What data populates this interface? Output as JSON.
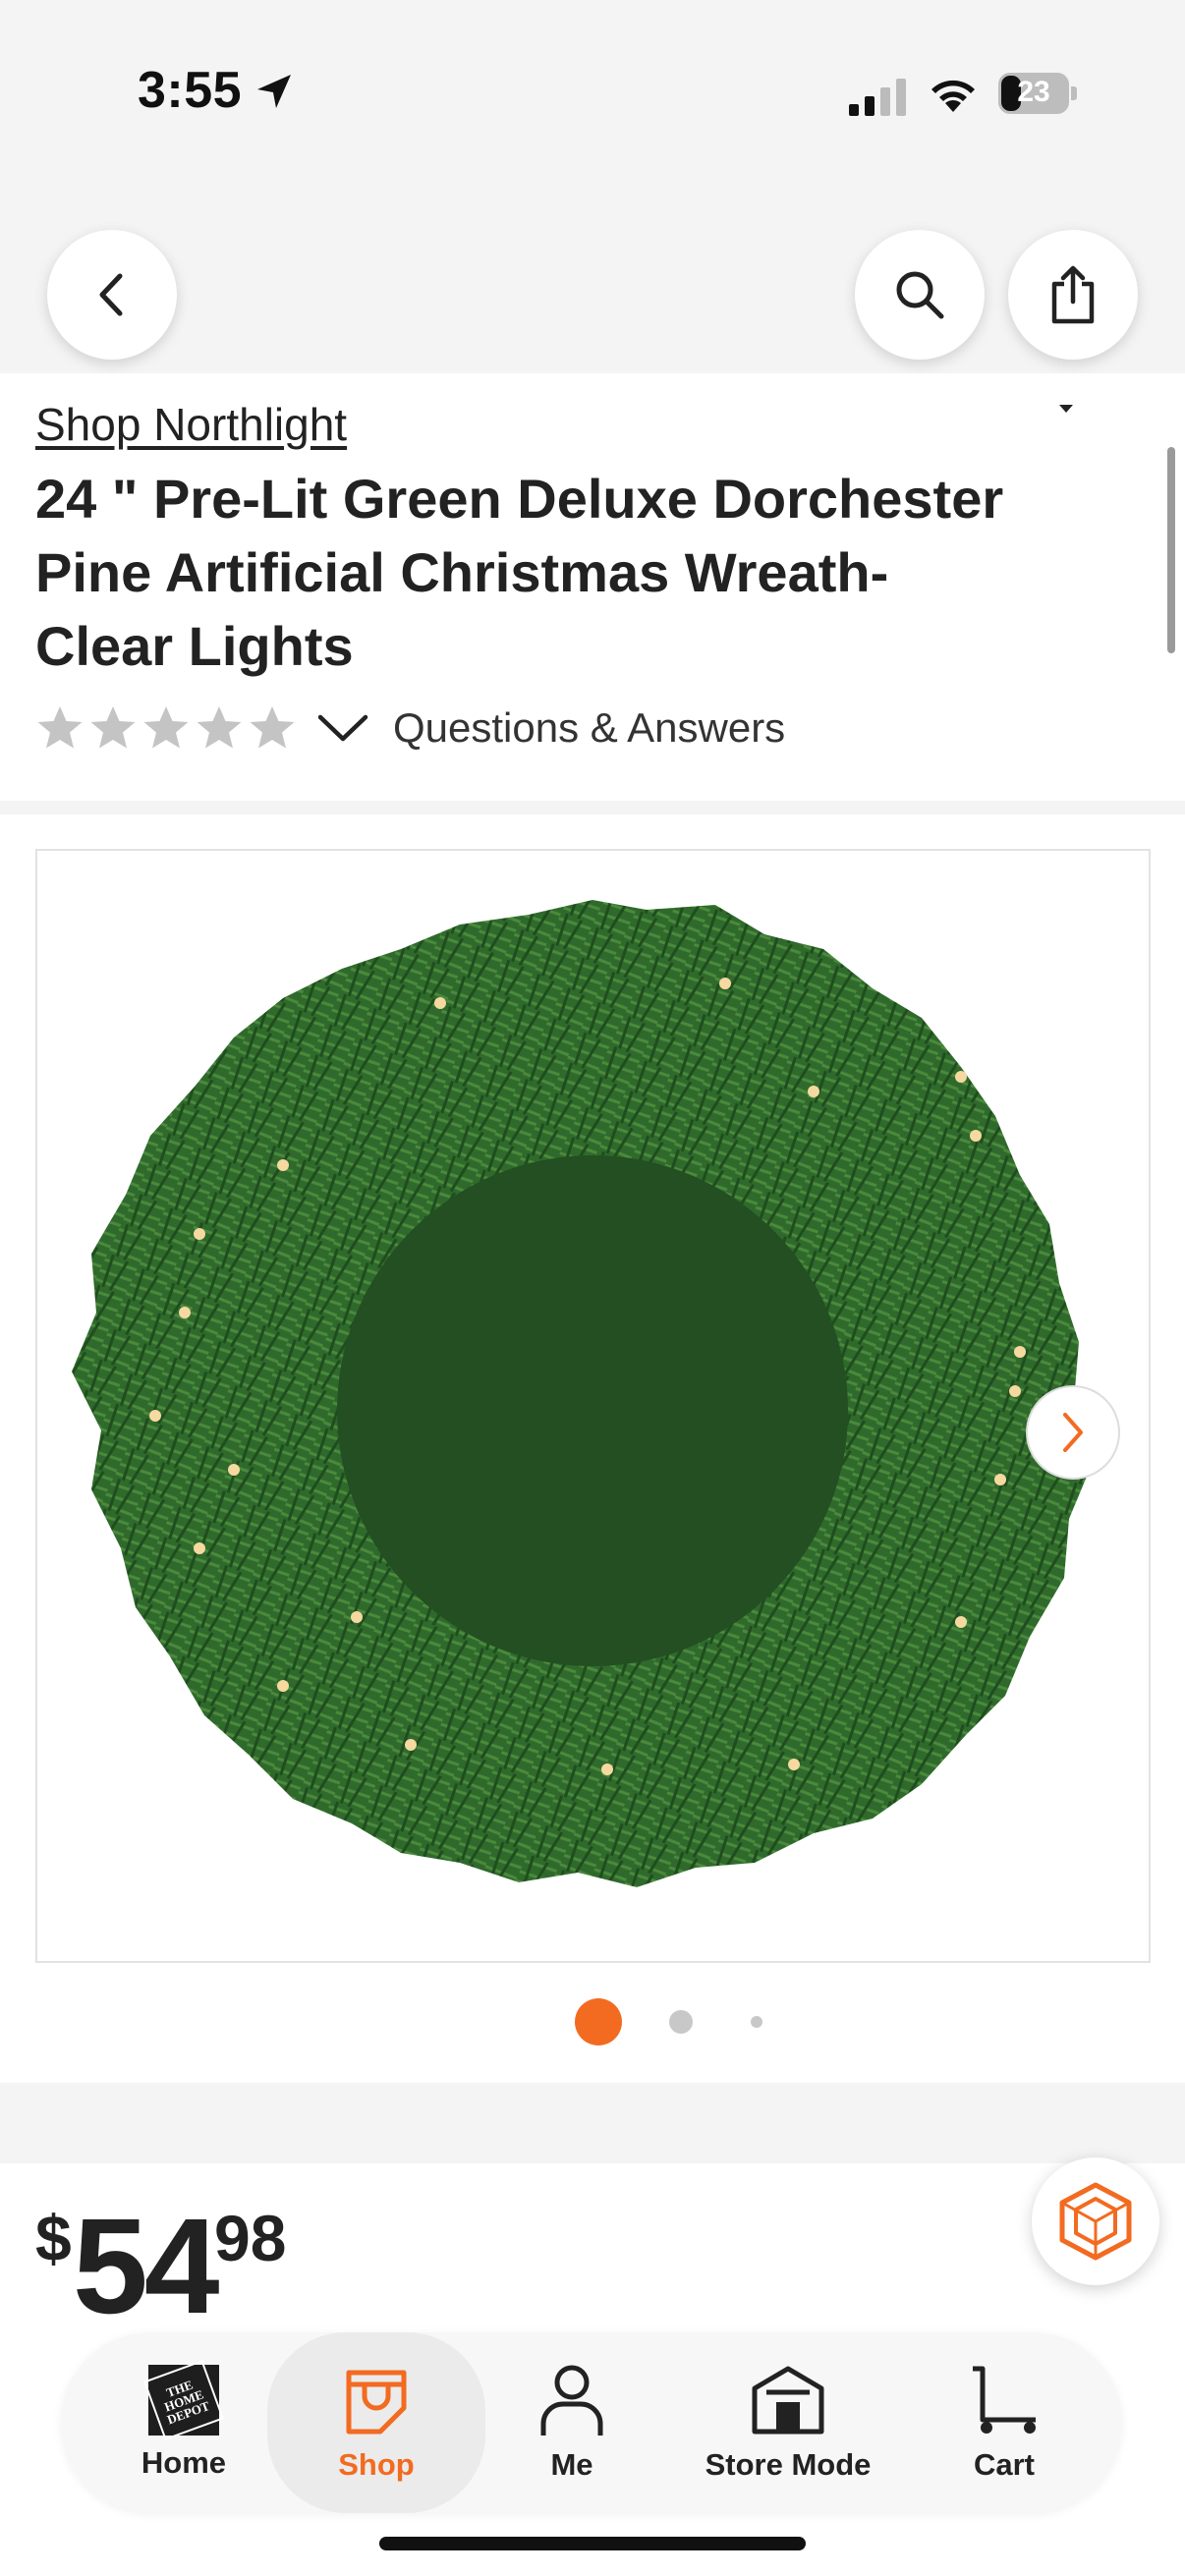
{
  "status_bar": {
    "time": "3:55",
    "battery": "23",
    "icons": [
      "location-arrow-icon",
      "cellular-signal-icon",
      "wifi-icon",
      "battery-icon"
    ]
  },
  "nav": {
    "back_icon": "chevron-left-icon",
    "search_icon": "search-icon",
    "share_icon": "share-icon"
  },
  "product": {
    "brand_link": "Shop Northlight",
    "title": "24 \" Pre-Lit Green Deluxe Dorchester Pine Artificial Christmas Wreath-Clear Lights",
    "rating_stars": 0,
    "rating_max": 5,
    "qa_label": "Questions & Answers",
    "image_count": 3,
    "active_image": 1
  },
  "price": {
    "dollar_sign": "$",
    "dollars": "54",
    "cents": "98"
  },
  "tabs": [
    {
      "label": "Home",
      "icon": "home-depot-logo-icon",
      "active": false
    },
    {
      "label": "Shop",
      "icon": "shop-bag-icon",
      "active": true
    },
    {
      "label": "Me",
      "icon": "person-icon",
      "active": false
    },
    {
      "label": "Store Mode",
      "icon": "store-icon",
      "active": false
    },
    {
      "label": "Cart",
      "icon": "cart-icon",
      "active": false
    }
  ],
  "colors": {
    "accent": "#f26b21",
    "text": "#222222",
    "star_empty": "#c4c4c4",
    "wreath_green": "#2f6a2c"
  }
}
